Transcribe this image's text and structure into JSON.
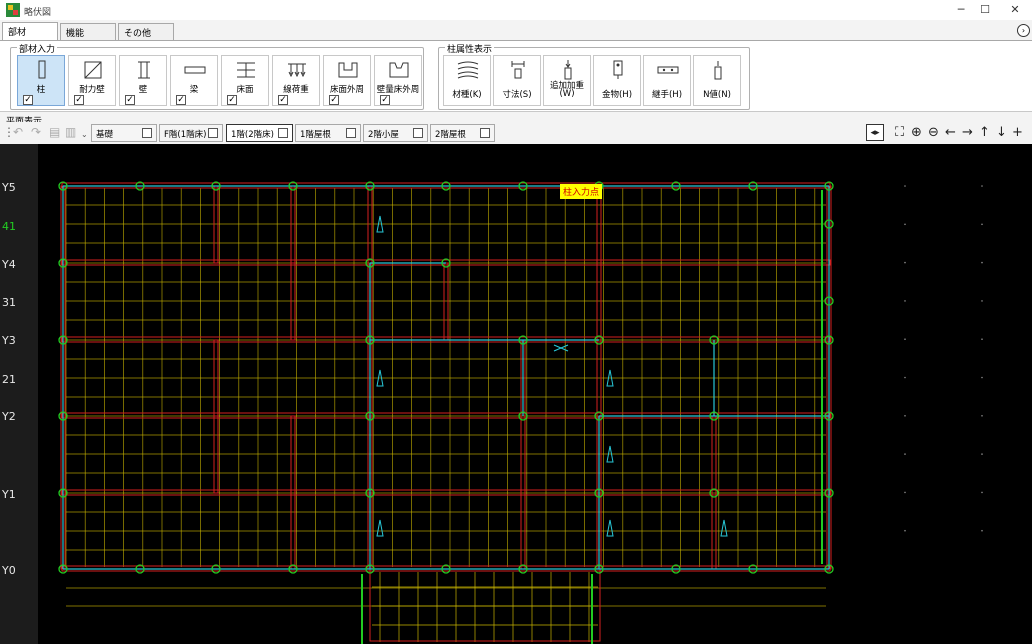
{
  "window": {
    "title": "略伏図",
    "controls": [
      "─",
      "☐",
      "✕"
    ]
  },
  "tabs": [
    {
      "label": "部材",
      "active": true
    },
    {
      "label": "機能",
      "active": false
    },
    {
      "label": "その他",
      "active": false
    }
  ],
  "ribbon": {
    "member_input_label": "部材入力",
    "member_buttons": [
      {
        "label": "柱",
        "checked": true,
        "selected": true,
        "icon": "column-icon"
      },
      {
        "label": "耐力壁",
        "checked": true,
        "icon": "bearing-wall-icon"
      },
      {
        "label": "壁",
        "checked": true,
        "icon": "wall-icon"
      },
      {
        "label": "梁",
        "checked": true,
        "icon": "beam-icon"
      },
      {
        "label": "床面",
        "checked": true,
        "icon": "floor-icon"
      },
      {
        "label": "線荷重",
        "checked": true,
        "icon": "line-load-icon"
      },
      {
        "label": "床面外周",
        "checked": true,
        "icon": "floor-perimeter-icon"
      },
      {
        "label": "壁量床外周",
        "checked": true,
        "icon": "wall-floor-perimeter-icon"
      }
    ],
    "column_attr_label": "柱属性表示",
    "attr_buttons": [
      {
        "label": "材種(K)",
        "icon": "material-icon"
      },
      {
        "label": "寸法(S)",
        "icon": "dimension-icon"
      },
      {
        "label": "追加加重",
        "label2": "(W)",
        "icon": "additional-load-icon"
      },
      {
        "label": "金物(H)",
        "icon": "hardware-icon"
      },
      {
        "label": "継手(H)",
        "icon": "joint-icon"
      },
      {
        "label": "N値(N)",
        "icon": "n-value-icon"
      }
    ]
  },
  "view": {
    "label": "平面表示",
    "floor_tabs": [
      {
        "label": "基礎",
        "active": false
      },
      {
        "label": "F階(1階床)",
        "active": false
      },
      {
        "label": "1階(2階床)",
        "active": true
      },
      {
        "label": "1階屋根",
        "active": false
      },
      {
        "label": "2階小屋",
        "active": false
      },
      {
        "label": "2階屋根",
        "active": false
      }
    ],
    "right_tools": [
      "◂▸",
      "⛶",
      "⊕",
      "⊖",
      "←",
      "→",
      "↑",
      "↓",
      "+"
    ]
  },
  "canvas": {
    "hint": "柱入力点",
    "axis_labels": [
      {
        "label": "Y5",
        "green": false
      },
      {
        "label": "41",
        "green": true
      },
      {
        "label": "Y4",
        "green": false
      },
      {
        "label": "31",
        "green": false
      },
      {
        "label": "Y3",
        "green": false
      },
      {
        "label": "21",
        "green": false
      },
      {
        "label": "Y2",
        "green": false
      },
      {
        "label": "Y1",
        "green": false
      },
      {
        "label": "Y0",
        "green": false
      }
    ]
  },
  "colors": {
    "wall_red": "#d42020",
    "grid_yellow": "#c8b400",
    "beam_cyan": "#28c8d8",
    "node_green": "#22cc22",
    "hint_yellow": "#ffff00"
  }
}
